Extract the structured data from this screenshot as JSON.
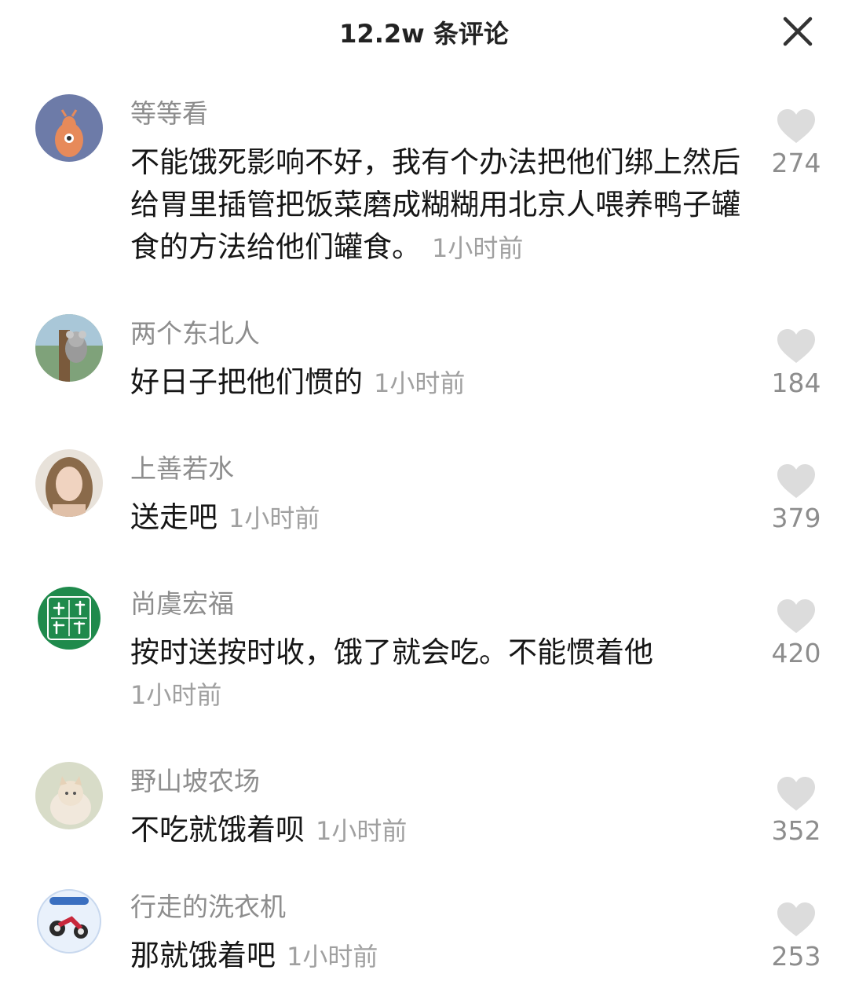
{
  "header": {
    "title": "12.2w 条评论",
    "close_icon": "close-icon"
  },
  "colors": {
    "username": "#8d8d8d",
    "text": "#161616",
    "timestamp": "#a0a0a0",
    "heart": "#dcdcdc"
  },
  "comments": [
    {
      "username": "等等看",
      "text": "不能饿死影响不好，我有个办法把他们绑上然后给胃里插管把饭菜磨成糊糊用北京人喂养鸭子罐食的方法给他们罐食。",
      "time": "1小时前",
      "likes": "274",
      "avatar": "cartoon-deer-avatar"
    },
    {
      "username": "两个东北人",
      "text": "好日子把他们惯的",
      "time": "1小时前",
      "likes": "184",
      "avatar": "koala-photo-avatar"
    },
    {
      "username": "上善若水",
      "text": "送走吧",
      "time": "1小时前",
      "likes": "379",
      "avatar": "woman-portrait-avatar"
    },
    {
      "username": "尚虞宏福",
      "text": "按时送按时收，饿了就会吃。不能惯着他",
      "time": "1小时前",
      "likes": "420",
      "avatar": "seal-logo-avatar",
      "avatar_text": "尚虞宏福"
    },
    {
      "username": "野山坡农场",
      "text": "不吃就饿着呗",
      "time": "1小时前",
      "likes": "352",
      "avatar": "cat-photo-avatar"
    },
    {
      "username": "行走的洗衣机",
      "text": "那就饿着吧",
      "time": "1小时前",
      "likes": "253",
      "avatar": "motorcycle-logo-avatar"
    }
  ]
}
